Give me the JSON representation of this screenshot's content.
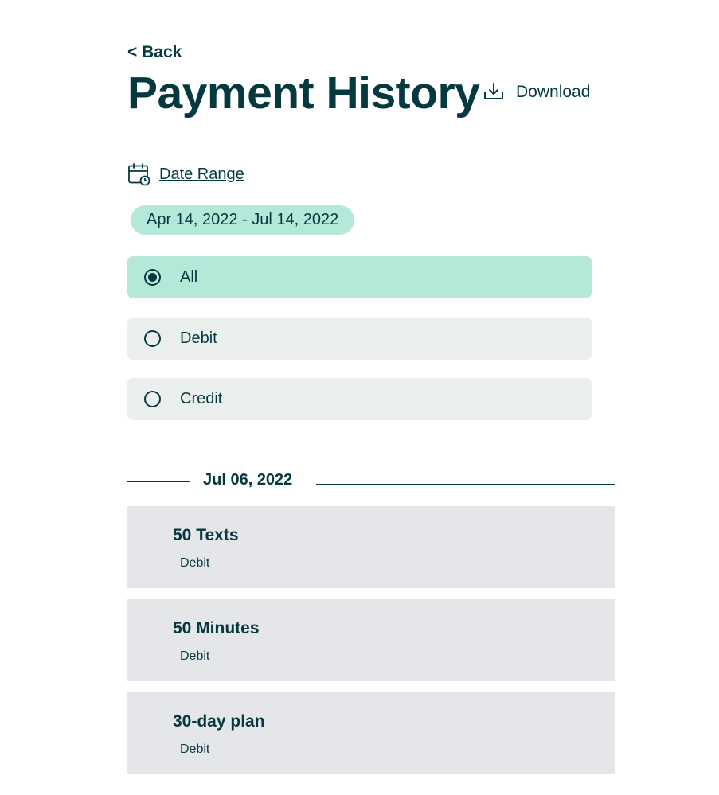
{
  "nav": {
    "back_label": "< Back"
  },
  "header": {
    "title": "Payment History",
    "download_label": "Download",
    "download_icon": "download-icon"
  },
  "date_filter": {
    "link_label": "Date Range",
    "icon": "calendar-clock-icon",
    "selected_range": "Apr 14, 2022 - Jul 14, 2022"
  },
  "type_filter": {
    "selected": "All",
    "options": [
      {
        "label": "All",
        "selected": true
      },
      {
        "label": "Debit",
        "selected": false
      },
      {
        "label": "Credit",
        "selected": false
      }
    ]
  },
  "transactions": {
    "groups": [
      {
        "date": "Jul 06, 2022",
        "items": [
          {
            "title": "50 Texts",
            "type": "Debit"
          },
          {
            "title": "50 Minutes",
            "type": "Debit"
          },
          {
            "title": "30-day plan",
            "type": "Debit"
          }
        ]
      }
    ]
  },
  "colors": {
    "primary_text": "#06393f",
    "selected_bg": "#b4e9d9",
    "option_bg": "#eaeeed",
    "card_bg": "#e5e6ea",
    "page_bg": "#ffffff"
  }
}
